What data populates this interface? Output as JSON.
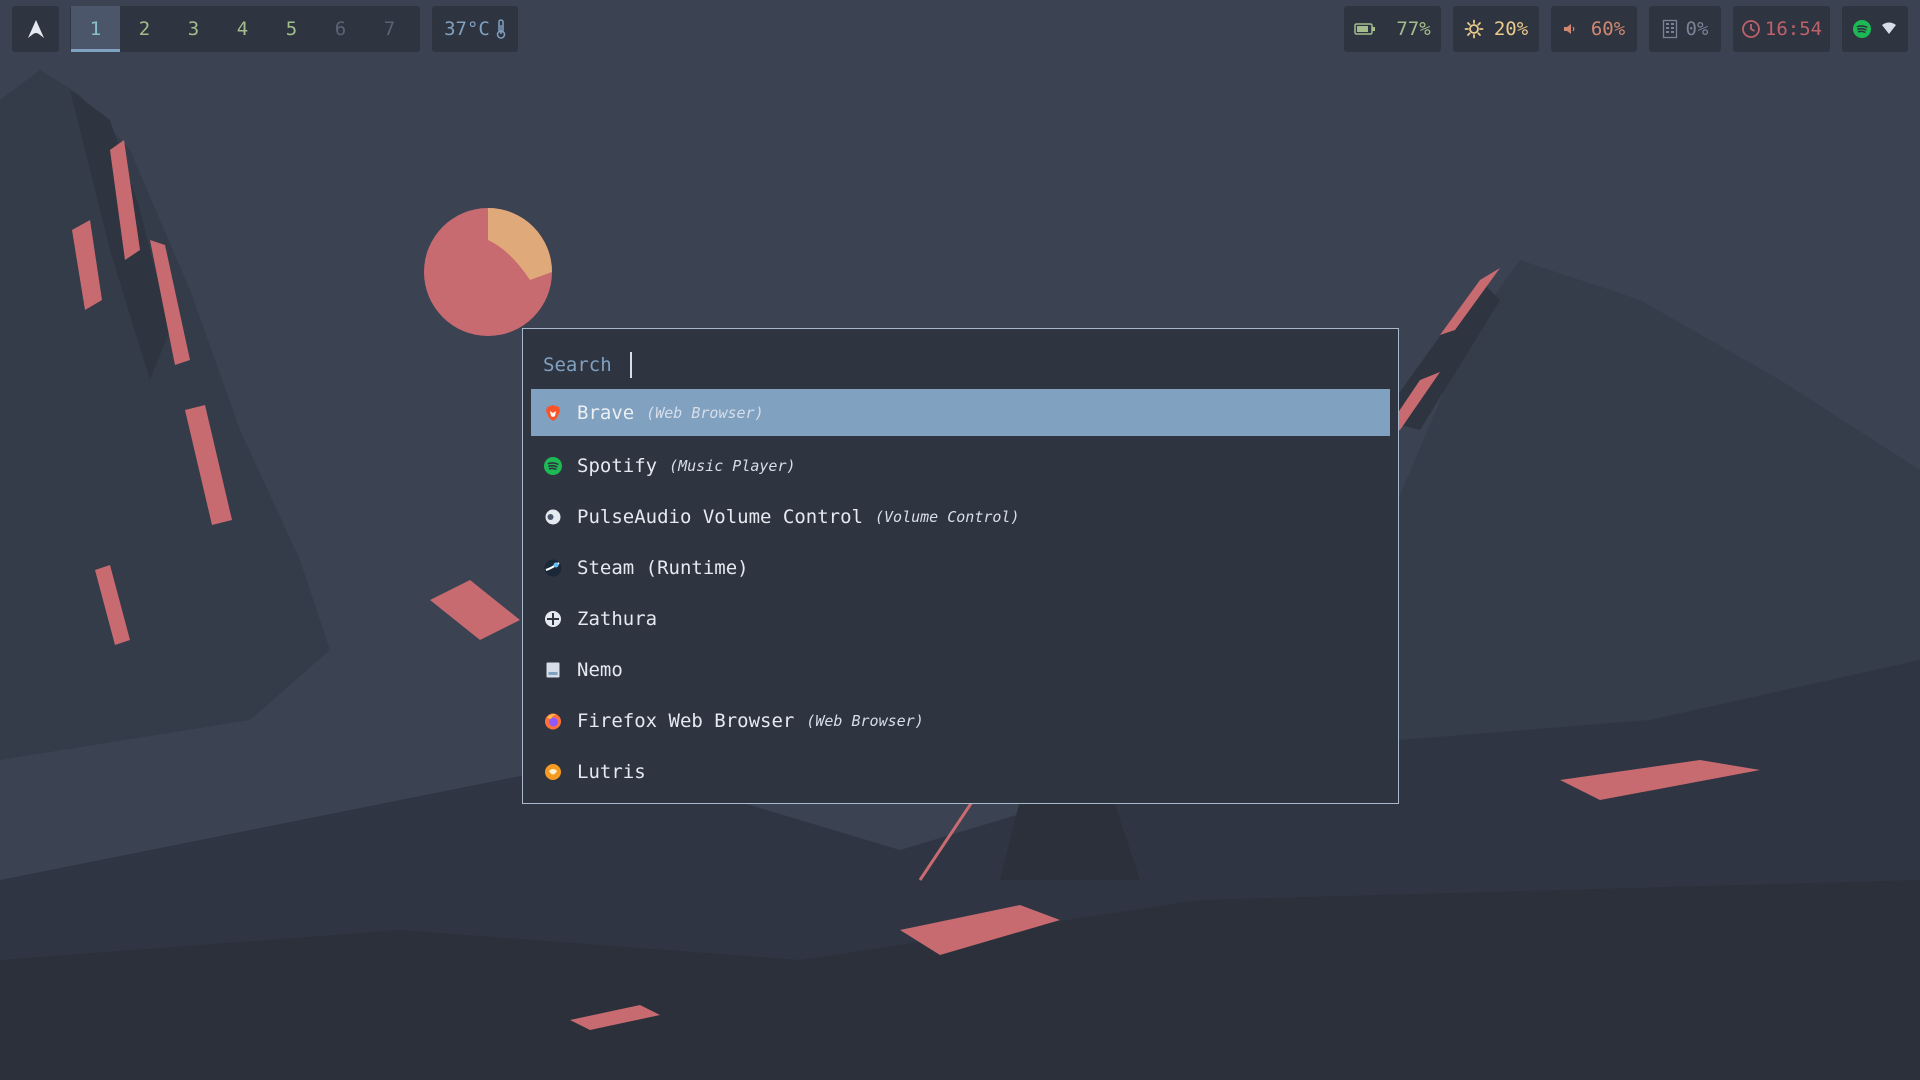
{
  "bar": {
    "launcher_icon": "arch-logo-icon",
    "workspaces": [
      {
        "label": "1",
        "state": "active"
      },
      {
        "label": "2",
        "state": "occupied"
      },
      {
        "label": "3",
        "state": "occupied"
      },
      {
        "label": "4",
        "state": "occupied"
      },
      {
        "label": "5",
        "state": "occupied"
      },
      {
        "label": "6",
        "state": "empty"
      },
      {
        "label": "7",
        "state": "empty"
      }
    ],
    "temperature": "37°C",
    "battery": "77%",
    "brightness": "20%",
    "volume": "60%",
    "memory": "0%",
    "clock": "16:54",
    "colors": {
      "bar_bg": "#2e3440",
      "green": "#a3be8c",
      "yellow": "#ebcb8b",
      "orange": "#d08770",
      "red": "#bf616a",
      "blue": "#81a1c1"
    }
  },
  "launcher": {
    "search_label": "Search",
    "search_value": "",
    "items": [
      {
        "name": "Brave",
        "generic": "(Web Browser)",
        "icon": "brave-icon",
        "selected": true
      },
      {
        "name": "Spotify",
        "generic": "(Music Player)",
        "icon": "spotify-icon",
        "selected": false
      },
      {
        "name": "PulseAudio Volume Control",
        "generic": "(Volume Control)",
        "icon": "pulseaudio-icon",
        "selected": false
      },
      {
        "name": "Steam (Runtime)",
        "generic": "",
        "icon": "steam-icon",
        "selected": false
      },
      {
        "name": "Zathura",
        "generic": "",
        "icon": "zathura-icon",
        "selected": false
      },
      {
        "name": "Nemo",
        "generic": "",
        "icon": "nemo-icon",
        "selected": false
      },
      {
        "name": "Firefox Web Browser",
        "generic": "(Web Browser)",
        "icon": "firefox-icon",
        "selected": false
      },
      {
        "name": "Lutris",
        "generic": "",
        "icon": "lutris-icon",
        "selected": false
      }
    ]
  }
}
